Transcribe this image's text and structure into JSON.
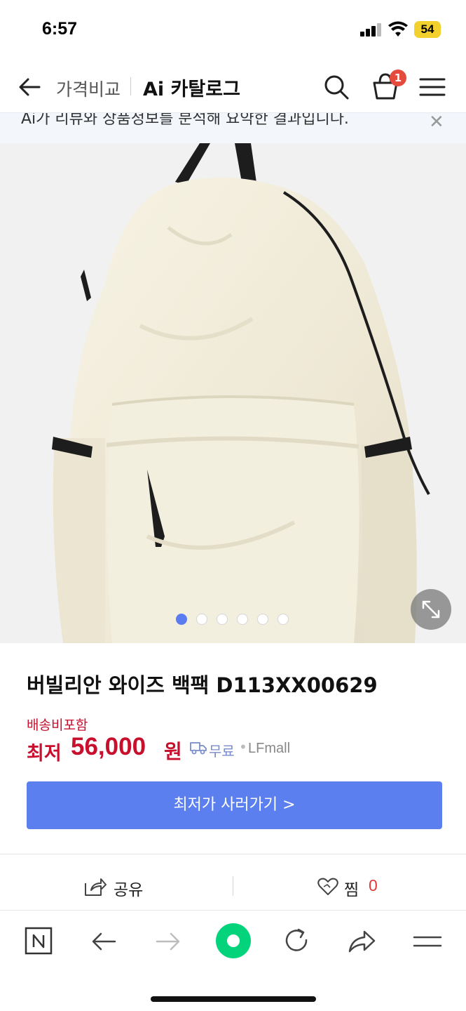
{
  "status_bar": {
    "time": "6:57",
    "battery": "54",
    "battery_color": "#f2d12f"
  },
  "header": {
    "breadcrumb_price_compare": "가격비교",
    "breadcrumb_catalog": "Ai 카탈로그",
    "cart_badge": "1",
    "icons": [
      "back-arrow-icon",
      "search-icon",
      "basket-icon",
      "hamburger-menu-icon"
    ]
  },
  "notice": {
    "text": "Ai가 리뷰와 상품정보를 분석해 요약한 결과입니다."
  },
  "gallery": {
    "image_count": 6,
    "active_index": 0,
    "icons": [
      "expand-icon"
    ]
  },
  "product": {
    "title": "버빌리안 와이즈 백팩 D113XX00629",
    "shipping_note": "배송비포함",
    "price_label": "최저",
    "price_value": "56,000",
    "price_unit": "원",
    "shipping_fee": "무료",
    "separator": "•",
    "mall": "LFmall",
    "buy_button": "최저가 사러가기 >"
  },
  "actions": {
    "share_label": "공유",
    "zzim_label": "찜",
    "zzim_count": "0"
  },
  "bottom_nav": {
    "items": [
      "naver-n-icon",
      "back-icon",
      "forward-icon",
      "green-dot-icon",
      "reload-icon",
      "share-arrow-icon",
      "menu-icon"
    ]
  },
  "colors": {
    "accent_blue": "#5b7fef",
    "price_red": "#c8102e",
    "badge_red": "#e54b3c",
    "naver_green": "#03d47c"
  }
}
